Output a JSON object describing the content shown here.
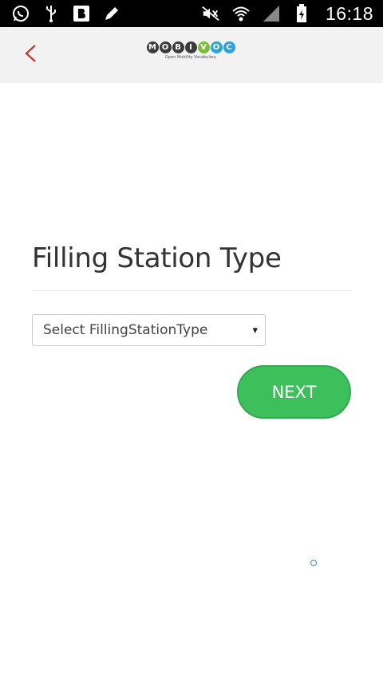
{
  "status_bar": {
    "time": "16:18",
    "left_icons": [
      "whatsapp-icon",
      "usb-icon",
      "blogger-icon",
      "pen-icon"
    ],
    "right_icons": [
      "mute-icon",
      "wifi-icon",
      "signal-icon",
      "battery-icon"
    ]
  },
  "app_bar": {
    "back_icon": "chevron-left-icon",
    "logo_letters": [
      "M",
      "O",
      "B",
      "I",
      "V",
      "O",
      "C"
    ],
    "logo_tagline": "Open Mobility Vocabulary",
    "colors": {
      "back": "#c0392b",
      "background": "#f2f2f2"
    }
  },
  "main": {
    "title": "Filling Station Type",
    "select": {
      "value": "Select FillingStationType",
      "caret": "▾"
    },
    "next_button": {
      "label": "NEXT",
      "color": "#3dbf5c"
    }
  }
}
